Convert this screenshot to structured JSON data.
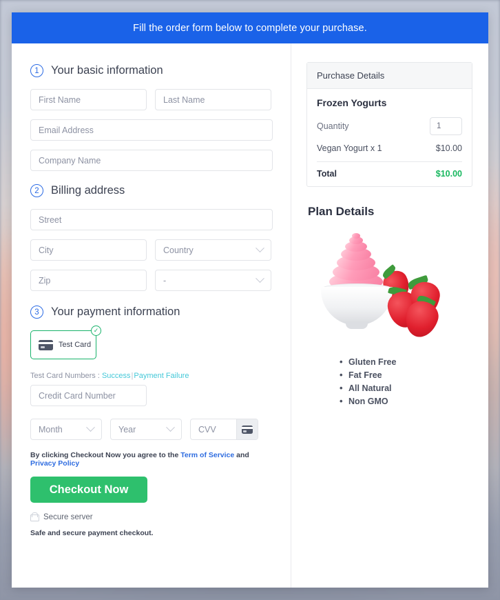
{
  "banner": {
    "text": "Fill the order form below to complete your purchase."
  },
  "basic": {
    "step": "1",
    "title": "Your basic information",
    "first_name_placeholder": "First Name",
    "last_name_placeholder": "Last Name",
    "email_placeholder": "Email Address",
    "company_placeholder": "Company Name"
  },
  "billing": {
    "step": "2",
    "title": "Billing address",
    "street_placeholder": "Street",
    "city_placeholder": "City",
    "country_placeholder": "Country",
    "zip_placeholder": "Zip",
    "state_placeholder": "-"
  },
  "payment": {
    "step": "3",
    "title": "Your payment information",
    "test_card_label": "Test Card",
    "selected_check": "✓",
    "test_numbers_prefix": "Test Card Numbers :",
    "success_link": "Success",
    "separator": "|",
    "failure_link": "Payment Failure",
    "card_number_placeholder": "Credit Card Number",
    "month_placeholder": "Month",
    "year_placeholder": "Year",
    "cvv_placeholder": "CVV"
  },
  "terms": {
    "lead": "By clicking Checkout Now you agree to the",
    "tos_link": "Term of Service",
    "and": "and",
    "privacy_link": "Privacy Policy"
  },
  "actions": {
    "checkout_label": "Checkout Now",
    "secure_server": "Secure server",
    "safe_note": "Safe and secure payment checkout."
  },
  "purchase": {
    "header": "Purchase Details",
    "product": "Frozen Yogurts",
    "quantity_label": "Quantity",
    "quantity_value": "1",
    "line_item_label": "Vegan Yogurt x 1",
    "line_item_price": "$10.00",
    "total_label": "Total",
    "total_value": "$10.00"
  },
  "plan": {
    "title": "Plan Details",
    "features": [
      "Gluten Free",
      "Fat Free",
      "All Natural",
      "Non GMO"
    ]
  },
  "colors": {
    "banner_blue": "#1a62e8",
    "step_blue": "#2a6ae4",
    "checkout_green": "#2ec06d",
    "total_green": "#18b85f",
    "card_border_green": "#17b26a",
    "test_link_teal": "#44c8d8",
    "terms_link_blue": "#2e6ce0"
  }
}
